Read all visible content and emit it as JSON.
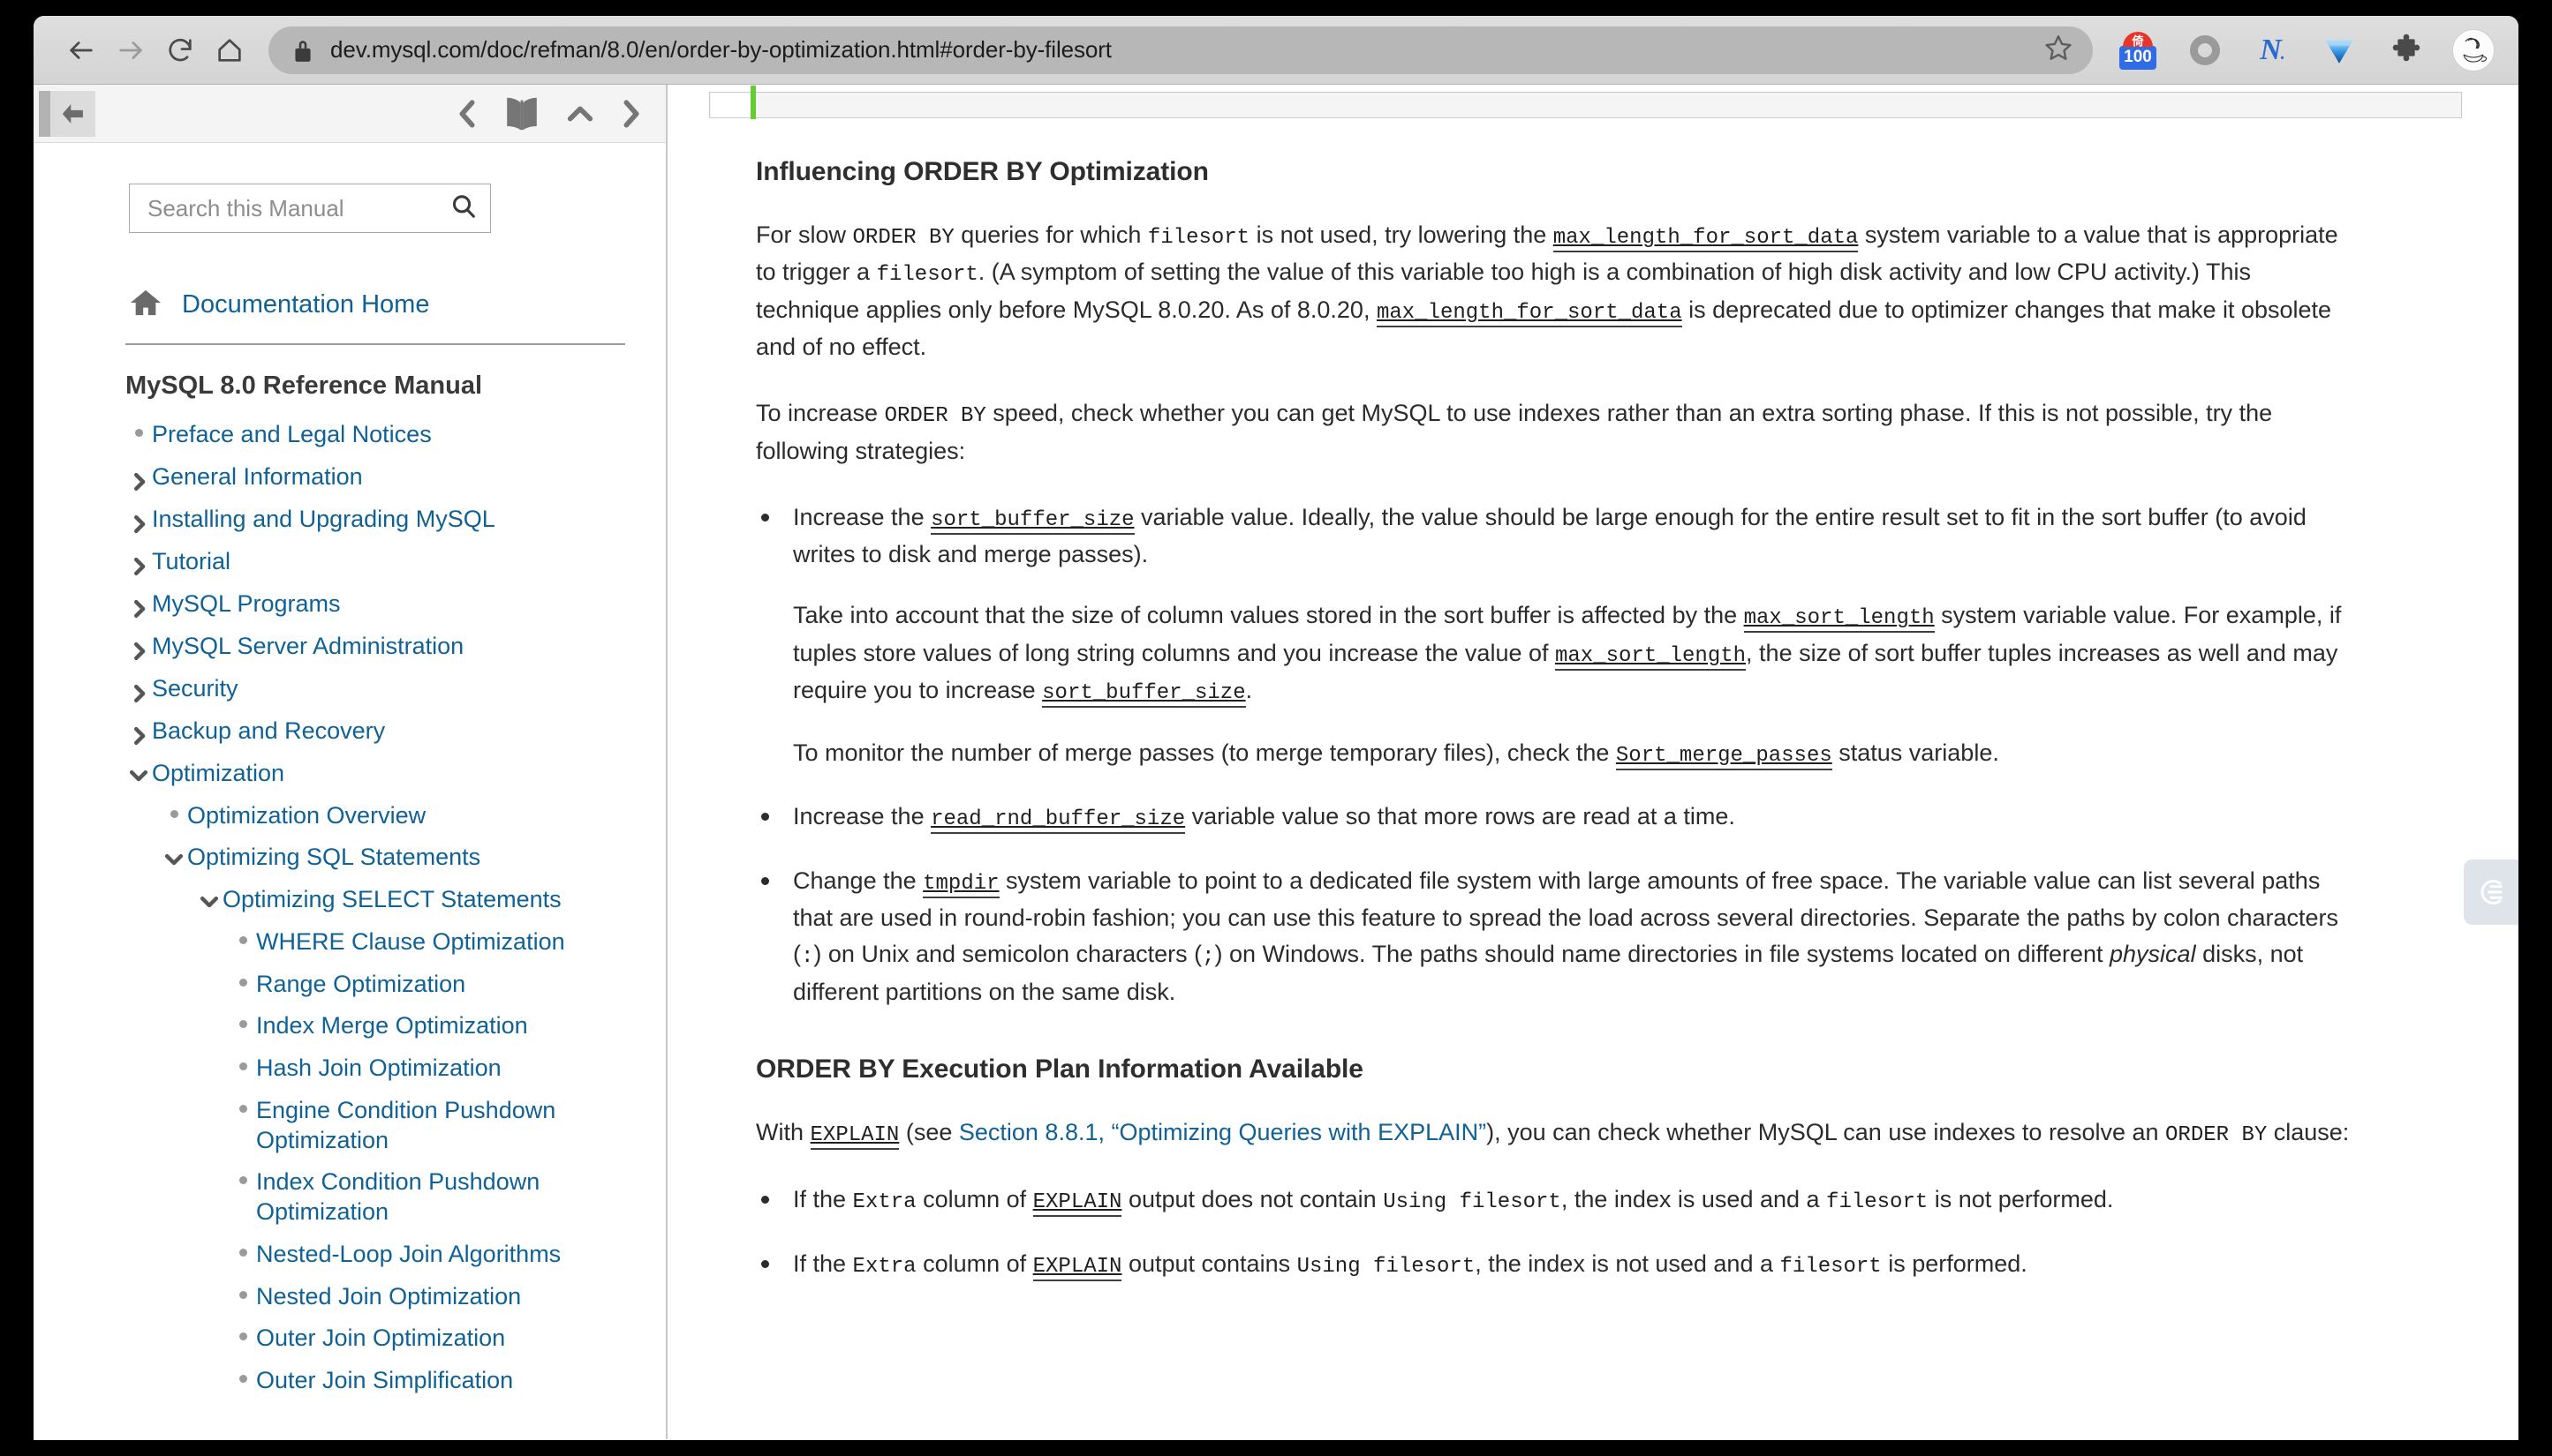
{
  "browser": {
    "url": "dev.mysql.com/doc/refman/8.0/en/order-by-optimization.html#order-by-filesort",
    "back_label": "Back",
    "forward_label": "Forward",
    "reload_label": "Reload",
    "home_label": "Home",
    "lock_icon": "lock-icon",
    "star_icon": "star-icon",
    "extensions": [
      {
        "name": "badge-100-extension",
        "badge_text": "100",
        "dome_text": "倚"
      },
      {
        "name": "ring-extension",
        "label": ""
      },
      {
        "name": "n-extension",
        "label": "N"
      },
      {
        "name": "diamond-extension",
        "label": ""
      },
      {
        "name": "puzzle-extensions-menu",
        "label": ""
      },
      {
        "name": "profile-avatar",
        "label": ""
      }
    ]
  },
  "sidebar": {
    "collapse_button_label": "",
    "nav_icons": [
      "prev-chevron-icon",
      "book-icon",
      "up-chevron-icon",
      "next-chevron-icon"
    ],
    "search": {
      "placeholder": "Search this Manual",
      "value": "",
      "icon": "search-icon"
    },
    "documentation_home": "Documentation Home",
    "manual_title": "MySQL 8.0 Reference Manual",
    "tree": [
      {
        "label": "Preface and Legal Notices",
        "level": 0,
        "marker": "dot"
      },
      {
        "label": "General Information",
        "level": 0,
        "marker": "chevron-right"
      },
      {
        "label": "Installing and Upgrading MySQL",
        "level": 0,
        "marker": "chevron-right"
      },
      {
        "label": "Tutorial",
        "level": 0,
        "marker": "chevron-right"
      },
      {
        "label": "MySQL Programs",
        "level": 0,
        "marker": "chevron-right"
      },
      {
        "label": "MySQL Server Administration",
        "level": 0,
        "marker": "chevron-right"
      },
      {
        "label": "Security",
        "level": 0,
        "marker": "chevron-right"
      },
      {
        "label": "Backup and Recovery",
        "level": 0,
        "marker": "chevron-right"
      },
      {
        "label": "Optimization",
        "level": 0,
        "marker": "chevron-down"
      },
      {
        "label": "Optimization Overview",
        "level": 1,
        "marker": "dot"
      },
      {
        "label": "Optimizing SQL Statements",
        "level": 1,
        "marker": "chevron-down"
      },
      {
        "label": "Optimizing SELECT Statements",
        "level": 2,
        "marker": "chevron-down"
      },
      {
        "label": "WHERE Clause Optimization",
        "level": 3,
        "marker": "dot"
      },
      {
        "label": "Range Optimization",
        "level": 3,
        "marker": "dot"
      },
      {
        "label": "Index Merge Optimization",
        "level": 3,
        "marker": "dot"
      },
      {
        "label": "Hash Join Optimization",
        "level": 3,
        "marker": "dot"
      },
      {
        "label": "Engine Condition Pushdown Optimization",
        "level": 3,
        "marker": "dot"
      },
      {
        "label": "Index Condition Pushdown Optimization",
        "level": 3,
        "marker": "dot"
      },
      {
        "label": "Nested-Loop Join Algorithms",
        "level": 3,
        "marker": "dot"
      },
      {
        "label": "Nested Join Optimization",
        "level": 3,
        "marker": "dot"
      },
      {
        "label": "Outer Join Optimization",
        "level": 3,
        "marker": "dot"
      },
      {
        "label": "Outer Join Simplification",
        "level": 3,
        "marker": "dot"
      }
    ]
  },
  "content": {
    "heading_1": "Influencing ORDER BY Optimization",
    "p1": {
      "s1": "For slow ",
      "c1": "ORDER BY",
      "s2": " queries for which ",
      "c2": "filesort",
      "s3": " is not used, try lowering the ",
      "v1": "max_length_for_sort_data",
      "s4": " system variable to a value that is appropriate to trigger a ",
      "c3": "filesort",
      "s5": ". (A symptom of setting the value of this variable too high is a combination of high disk activity and low CPU activity.) This technique applies only before MySQL 8.0.20. As of 8.0.20, ",
      "v2": "max_length_for_sort_data",
      "s6": " is deprecated due to optimizer changes that make it obsolete and of no effect."
    },
    "p2": {
      "s1": "To increase ",
      "c1": "ORDER BY",
      "s2": " speed, check whether you can get MySQL to use indexes rather than an extra sorting phase. If this is not possible, try the following strategies:"
    },
    "bullets_1": [
      {
        "paras": [
          {
            "s1": "Increase the ",
            "v1": "sort_buffer_size",
            "s2": " variable value. Ideally, the value should be large enough for the entire result set to fit in the sort buffer (to avoid writes to disk and merge passes)."
          },
          {
            "s1": "Take into account that the size of column values stored in the sort buffer is affected by the ",
            "v1": "max_sort_length",
            "s2": " system variable value. For example, if tuples store values of long string columns and you increase the value of ",
            "v2": "max_sort_length",
            "s3": ", the size of sort buffer tuples increases as well and may require you to increase ",
            "v3": "sort_buffer_size",
            "s4": "."
          },
          {
            "s1": "To monitor the number of merge passes (to merge temporary files), check the ",
            "v1": "Sort_merge_passes",
            "s2": " status variable."
          }
        ]
      },
      {
        "paras": [
          {
            "s1": "Increase the ",
            "v1": "read_rnd_buffer_size",
            "s2": " variable value so that more rows are read at a time."
          }
        ]
      },
      {
        "paras": [
          {
            "s1": "Change the ",
            "v1": "tmpdir",
            "s2": " system variable to point to a dedicated file system with large amounts of free space. The variable value can list several paths that are used in round-robin fashion; you can use this feature to spread the load across several directories. Separate the paths by colon characters (",
            "c1": ":",
            "s3": ") on Unix and semicolon characters (",
            "c2": ";",
            "s4": ") on Windows. The paths should name directories in file systems located on different ",
            "em1": "physical",
            "s5": " disks, not different partitions on the same disk."
          }
        ]
      }
    ],
    "heading_2": "ORDER BY Execution Plan Information Available",
    "p3": {
      "s1": "With ",
      "v1": "EXPLAIN",
      "s2": " (see ",
      "link": "Section 8.8.1, “Optimizing Queries with EXPLAIN”",
      "s3": "), you can check whether MySQL can use indexes to resolve an ",
      "c1": "ORDER BY",
      "s4": " clause:"
    },
    "bullets_2": [
      {
        "s1": "If the ",
        "c1": "Extra",
        "s2": " column of ",
        "v1": "EXPLAIN",
        "s3": " output does not contain ",
        "c2": "Using filesort",
        "s4": ", the index is used and a ",
        "c3": "filesort",
        "s5": " is not performed."
      },
      {
        "s1": "If the ",
        "c1": "Extra",
        "s2": " column of ",
        "v1": "EXPLAIN",
        "s3": " output contains ",
        "c2": "Using filesort",
        "s4": ", the index is not used and a ",
        "c3": "filesort",
        "s5": " is performed."
      }
    ],
    "side_widget": "web-clipper-tab"
  },
  "colors": {
    "link": "#0f6196",
    "content_link": "#126195",
    "heading": "#2e2e2e",
    "code_bar_green": "#66cc33",
    "badge_blue": "#2f6ce5",
    "badge_red": "#e8342a"
  }
}
